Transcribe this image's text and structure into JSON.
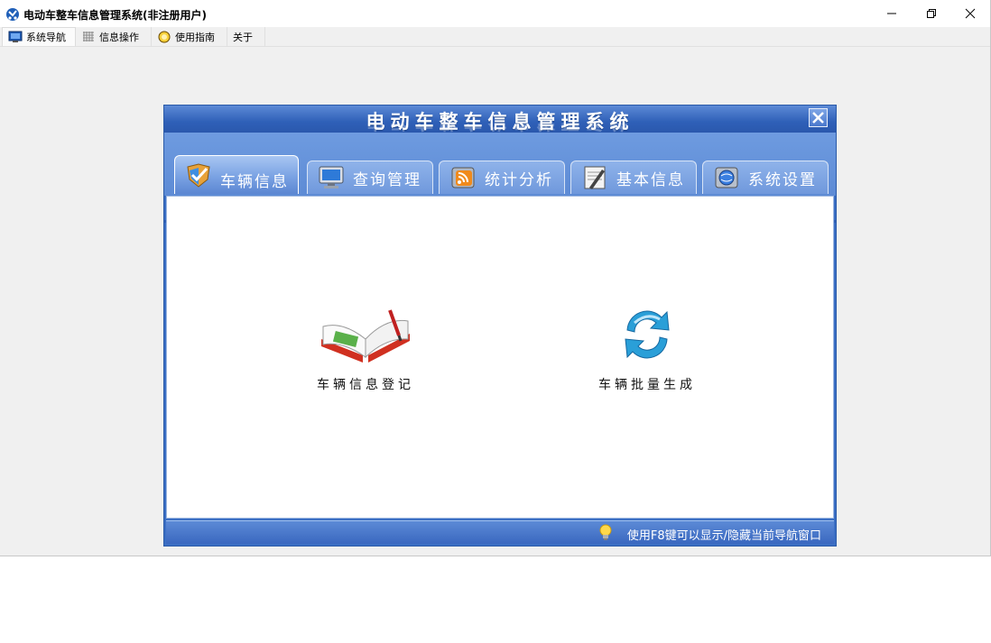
{
  "window": {
    "title": "电动车整车信息管理系统(非注册用户)",
    "controls": [
      "minimize-icon",
      "restore-icon",
      "close-icon"
    ]
  },
  "menu": {
    "items": [
      {
        "label": "系统导航",
        "icon": "monitor-icon",
        "active": true
      },
      {
        "label": "信息操作",
        "icon": "grid-icon",
        "active": false
      },
      {
        "label": "使用指南",
        "icon": "compass-icon",
        "active": false
      },
      {
        "label": "关于",
        "icon": "",
        "active": false
      }
    ]
  },
  "dialog": {
    "title": "电动车整车信息管理系统",
    "tabs": [
      {
        "label": "车辆信息",
        "icon": "shield-check-icon",
        "active": true
      },
      {
        "label": "查询管理",
        "icon": "computer-icon",
        "active": false
      },
      {
        "label": "统计分析",
        "icon": "rss-icon",
        "active": false
      },
      {
        "label": "基本信息",
        "icon": "notepad-icon",
        "active": false
      },
      {
        "label": "系统设置",
        "icon": "globe-window-icon",
        "active": false
      }
    ],
    "functions": [
      {
        "label": "车辆信息登记",
        "icon": "open-book-icon"
      },
      {
        "label": "车辆批量生成",
        "icon": "refresh-arrows-icon"
      }
    ],
    "status": {
      "hint": "使用F8键可以显示/隐藏当前导航窗口",
      "icon": "lightbulb-icon"
    }
  },
  "colors": {
    "dialog_blue": "#3b6fc4",
    "tab_strip": "#6e9be0",
    "content_bg": "#ffffff",
    "window_bg": "#f0f0f0"
  }
}
